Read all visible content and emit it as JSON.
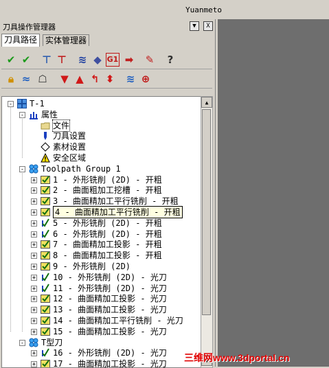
{
  "app_title": "Yuanmeto",
  "panel": {
    "title": "刀具操作管理器",
    "dropdown_glyph": "▼",
    "close_glyph": "X",
    "tabs": [
      {
        "label": "刀具路径"
      },
      {
        "label": "实体管理器"
      }
    ]
  },
  "toolbar1": [
    "select-all-ops",
    "select-dirty-ops",
    "regen-all",
    "regen-dirty",
    "backplot",
    "verify",
    "g1-post",
    "high-speed",
    "hatch-helper",
    "help"
  ],
  "toolbar2": [
    "lock",
    "wave-toggle",
    "ghost",
    "move-down",
    "move-up",
    "insert-arrow",
    "reorder",
    "display-toggle",
    "lasso"
  ],
  "tree": {
    "root": "T-1",
    "properties": "属性",
    "property_items": [
      {
        "label": "文件"
      },
      {
        "label": "刀具设置"
      },
      {
        "label": "素材设置"
      },
      {
        "label": "安全区域"
      }
    ],
    "group1": "Toolpath Group 1",
    "operations": [
      {
        "label": "1 - 外形铣削 (2D) - 开粗",
        "icon": "dirty"
      },
      {
        "label": "2 - 曲面粗加工挖槽 - 开粗",
        "icon": "dirty"
      },
      {
        "label": "3 - 曲面精加工平行铣削 - 开粗",
        "icon": "dirty"
      },
      {
        "label": "4 - 曲面精加工平行铣削 - 开粗",
        "icon": "dirty"
      },
      {
        "label": "5 - 外形铣削 (2D) - 开粗",
        "icon": "check"
      },
      {
        "label": "6 - 外形铣削 (2D) - 开粗",
        "icon": "check"
      },
      {
        "label": "7 - 曲面精加工投影 - 开粗",
        "icon": "dirty"
      },
      {
        "label": "8 - 曲面精加工投影 - 开粗",
        "icon": "dirty"
      },
      {
        "label": "9 - 外形铣削 (2D)",
        "icon": "dirty"
      },
      {
        "label": "10 - 外形铣削 (2D) - 光刀",
        "icon": "check"
      },
      {
        "label": "11 - 外形铣削 (2D) - 光刀",
        "icon": "check"
      },
      {
        "label": "12 - 曲面精加工投影 - 光刀",
        "icon": "dirty"
      },
      {
        "label": "13 - 曲面精加工投影 - 光刀",
        "icon": "dirty"
      },
      {
        "label": "14 - 曲面精加工平行铣削 - 光刀",
        "icon": "dirty"
      },
      {
        "label": "15 - 曲面精加工投影 - 光刀",
        "icon": "dirty"
      }
    ],
    "group2": "T型刀",
    "operations2": [
      {
        "label": "16 - 外形铣削 (2D) - 光刀",
        "icon": "check"
      },
      {
        "label": "17 - 曲面精加工投影 - 光刀",
        "icon": "dirty"
      }
    ]
  },
  "watermark": "三维网www.3dportal.cn",
  "colors": {
    "viewport": "#6e6e6e",
    "watermark": "#e00000",
    "accent_blue": "#1a5fd0"
  }
}
